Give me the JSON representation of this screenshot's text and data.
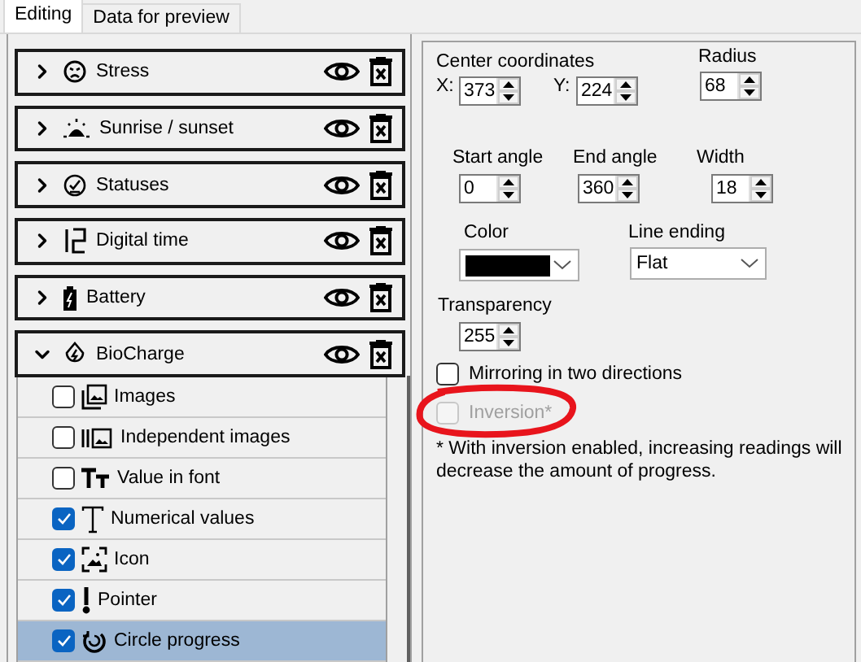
{
  "tabs": [
    {
      "label": "Editing",
      "selected": true
    },
    {
      "label": "Data for preview",
      "selected": false
    }
  ],
  "groups": [
    {
      "label": "Stress",
      "expanded": false
    },
    {
      "label": "Sunrise / sunset",
      "expanded": false
    },
    {
      "label": "Statuses",
      "expanded": false
    },
    {
      "label": "Digital time",
      "expanded": false
    },
    {
      "label": "Battery",
      "expanded": false
    },
    {
      "label": "BioCharge",
      "expanded": true,
      "children": [
        {
          "label": "Images",
          "checked": false,
          "selected": false
        },
        {
          "label": "Independent images",
          "checked": false,
          "selected": false
        },
        {
          "label": "Value in font",
          "checked": false,
          "selected": false
        },
        {
          "label": "Numerical values",
          "checked": true,
          "selected": false
        },
        {
          "label": "Icon",
          "checked": true,
          "selected": false
        },
        {
          "label": "Pointer",
          "checked": true,
          "selected": false
        },
        {
          "label": "Circle progress",
          "checked": true,
          "selected": true
        }
      ]
    }
  ],
  "settings": {
    "center_label": "Center coordinates",
    "x": {
      "label": "X:",
      "value": "373"
    },
    "y": {
      "label": "Y:",
      "value": "224"
    },
    "radius": {
      "label": "Radius",
      "value": "68"
    },
    "start_angle": {
      "label": "Start angle",
      "value": "0"
    },
    "end_angle": {
      "label": "End angle",
      "value": "360"
    },
    "width": {
      "label": "Width",
      "value": "18"
    },
    "color": {
      "label": "Color",
      "color": "#000000"
    },
    "line_ending": {
      "label": "Line ending",
      "value": "Flat"
    },
    "transparency": {
      "label": "Transparency",
      "value": "255"
    },
    "mirroring": {
      "label": "Mirroring in two directions",
      "checked": false,
      "disabled": false
    },
    "inversion": {
      "label": "Inversion*",
      "checked": false,
      "disabled": true
    },
    "note": "* With inversion enabled, increasing readings will decrease the amount of progress."
  }
}
